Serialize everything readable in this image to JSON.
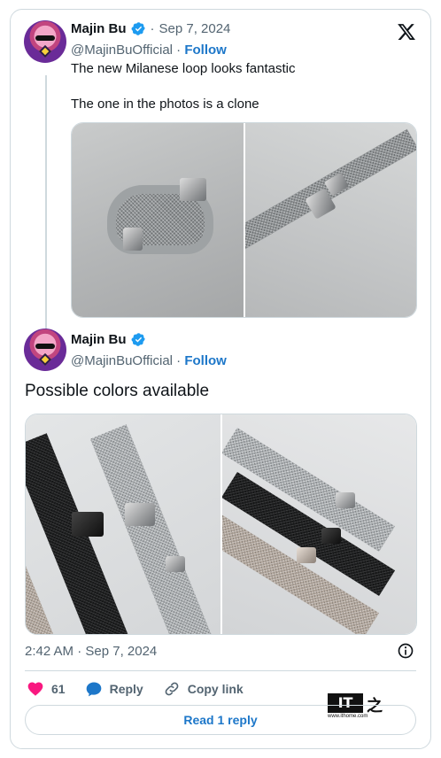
{
  "quoted_tweet": {
    "name": "Majin Bu",
    "date": "Sep 7, 2024",
    "separator": "·",
    "handle": "@MajinBuOfficial",
    "follow_label": "Follow",
    "line1": "The new Milanese loop looks fantastic",
    "line2": "The one in the photos is a clone"
  },
  "main_tweet": {
    "name": "Majin Bu",
    "handle": "@MajinBuOfficial",
    "separator": "·",
    "follow_label": "Follow",
    "text": "Possible colors available",
    "timestamp": "2:42 AM · Sep 7, 2024"
  },
  "actions": {
    "likes_count": "61",
    "reply_label": "Reply",
    "copy_link_label": "Copy link"
  },
  "read_reply_label": "Read 1 reply",
  "watermark": {
    "box_text": "IT",
    "char": "之",
    "url": "www.ithome.com"
  },
  "colors": {
    "accent_blue": "#1d77c9",
    "like_red": "#f91880",
    "verified_blue": "#1d9bf0",
    "muted_gray": "#536471"
  },
  "icons": [
    "verified-badge-icon",
    "x-logo-icon",
    "info-icon",
    "heart-icon",
    "reply-icon",
    "link-icon"
  ]
}
